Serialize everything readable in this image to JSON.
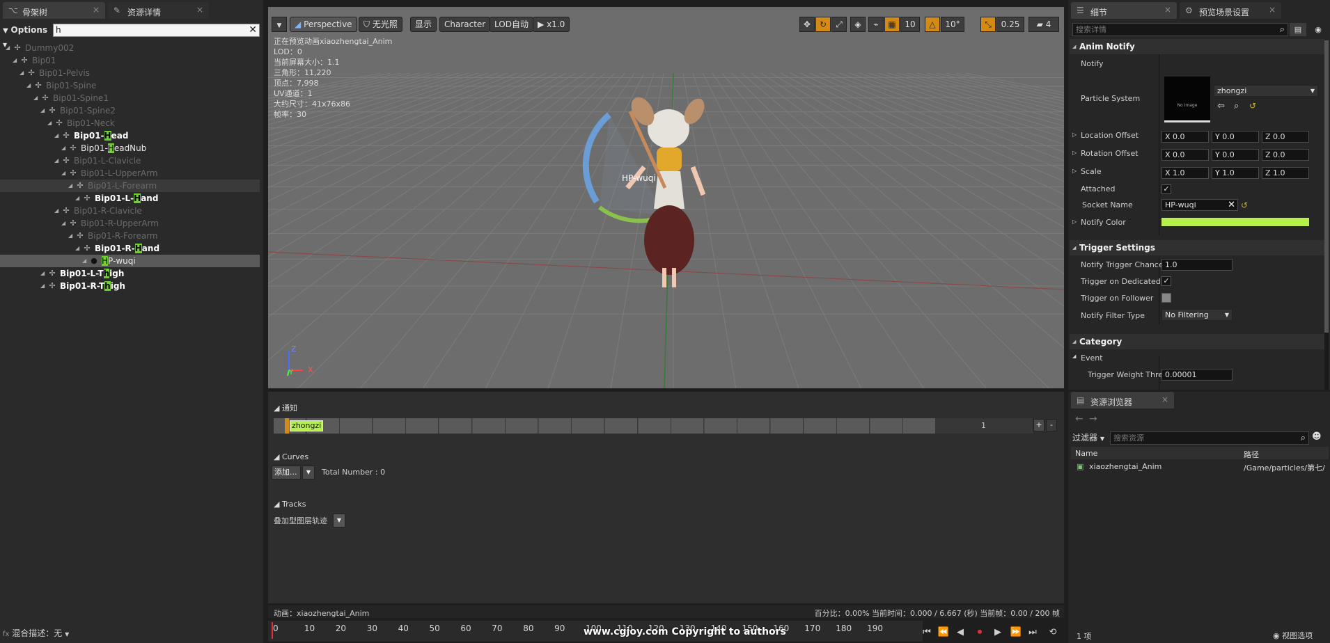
{
  "left_tabs": [
    {
      "label": "骨架树",
      "icon": "skeleton-icon"
    },
    {
      "label": "资源详情",
      "icon": "asset-details-icon"
    }
  ],
  "tree": {
    "options_label": "Options",
    "search_value": "h",
    "rows": [
      {
        "pre": "",
        "hl": "",
        "post": "Dummy002",
        "style": "dim",
        "indent": 0
      },
      {
        "pre": "",
        "hl": "",
        "post": "Bip01",
        "style": "dim",
        "indent": 1
      },
      {
        "pre": "",
        "hl": "",
        "post": "Bip01-Pelvis",
        "style": "dim",
        "indent": 2
      },
      {
        "pre": "",
        "hl": "",
        "post": "Bip01-Spine",
        "style": "dim",
        "indent": 3
      },
      {
        "pre": "",
        "hl": "",
        "post": "Bip01-Spine1",
        "style": "dim",
        "indent": 4
      },
      {
        "pre": "",
        "hl": "",
        "post": "Bip01-Spine2",
        "style": "dim",
        "indent": 5
      },
      {
        "pre": "",
        "hl": "",
        "post": "Bip01-Neck",
        "style": "dim",
        "indent": 6
      },
      {
        "pre": "Bip01-",
        "hl": "H",
        "post": "ead",
        "style": "bright",
        "indent": 7
      },
      {
        "pre": "Bip01-",
        "hl": "H",
        "post": "eadNub",
        "style": "normal",
        "indent": 8
      },
      {
        "pre": "",
        "hl": "",
        "post": "Bip01-L-Clavicle",
        "style": "dim",
        "indent": 7
      },
      {
        "pre": "",
        "hl": "",
        "post": "Bip01-L-UpperArm",
        "style": "dim",
        "indent": 8
      },
      {
        "pre": "",
        "hl": "",
        "post": "Bip01-L-Forearm",
        "style": "dim",
        "indent": 9
      },
      {
        "pre": "Bip01-L-",
        "hl": "H",
        "post": "and",
        "style": "bright",
        "indent": 10
      },
      {
        "pre": "",
        "hl": "",
        "post": "Bip01-R-Clavicle",
        "style": "dim",
        "indent": 7
      },
      {
        "pre": "",
        "hl": "",
        "post": "Bip01-R-UpperArm",
        "style": "dim",
        "indent": 8
      },
      {
        "pre": "",
        "hl": "",
        "post": "Bip01-R-Forearm",
        "style": "dim",
        "indent": 9
      },
      {
        "pre": "Bip01-R-",
        "hl": "H",
        "post": "and",
        "style": "bright",
        "indent": 10
      },
      {
        "pre": "",
        "hl": "H",
        "post": "P-wuqi",
        "style": "socket",
        "indent": 11
      },
      {
        "pre": "Bip01-L-T",
        "hl": "h",
        "post": "igh",
        "style": "bright",
        "indent": 5
      },
      {
        "pre": "Bip01-R-T",
        "hl": "h",
        "post": "igh",
        "style": "bright",
        "indent": 5
      }
    ],
    "bottom_label": "混合描述：无"
  },
  "viewport": {
    "toolbar": {
      "perspective": "Perspective",
      "lighting": "无光照",
      "show": "显示",
      "character": "Character",
      "lod": "LOD自动",
      "speed": "x1.0",
      "grid_snap": "10",
      "rot_snap": "10°",
      "scale_snap": "0.25",
      "cam_speed": "4"
    },
    "info_lines": [
      "正在预览动画xiaozhengtai_Anim",
      "LOD：0",
      "当前屏幕大小：1.1",
      "三角形：11,220",
      "顶点：7,998",
      "UV通道：1",
      "大约尺寸：41x76x86",
      "帧率：30"
    ],
    "socket_label": "HP-wuqi",
    "axis_z": "Z",
    "axis_y": "Y",
    "axis_x": "X"
  },
  "notify": {
    "section_notify": "通知",
    "notify_name": "zhongzi",
    "track_number": "1",
    "add_btn": "+",
    "remove_btn": "-",
    "section_curves": "Curves",
    "add_label": "添加...",
    "total_number": "Total Number : 0",
    "section_tracks": "Tracks",
    "tracks_dropdown": "叠加型图层轨迹"
  },
  "status": {
    "anim_name": "动画：xiaozhengtai_Anim",
    "progress": "百分比：0.00%  当前时间：0.000 / 6.667 (秒) 当前帧：0.00 / 200 帧"
  },
  "timeline": {
    "ticks": [
      "0",
      "10",
      "20",
      "30",
      "40",
      "50",
      "60",
      "70",
      "80",
      "90",
      "100",
      "110",
      "120",
      "130",
      "140",
      "150",
      "160",
      "170",
      "180",
      "190"
    ],
    "watermark": "www.cgjoy.com Copyright to authors",
    "playhead_fraction": 0.0
  },
  "details": {
    "tabs": [
      {
        "label": "细节",
        "icon": "details-icon"
      },
      {
        "label": "预览场景设置",
        "icon": "scene-settings-icon"
      }
    ],
    "search_placeholder": "搜索详情",
    "anim_notify_title": "Anim Notify",
    "notify_label": "Notify",
    "particle_label": "Particle System",
    "particle_value": "zhongzi",
    "no_image": "No Image",
    "location_label": "Location Offset",
    "rotation_label": "Rotation Offset",
    "scale_label": "Scale",
    "location": [
      "X 0.0",
      "Y 0.0",
      "Z 0.0"
    ],
    "rotation": [
      "X 0.0",
      "Y 0.0",
      "Z 0.0"
    ],
    "scale": [
      "X 1.0",
      "Y 1.0",
      "Z 1.0"
    ],
    "attached_label": "Attached",
    "socket_label": "Socket Name",
    "socket_value": "HP-wuqi",
    "color_label": "Notify Color",
    "notify_color": "#b6f04a",
    "trigger_title": "Trigger Settings",
    "chance_label": "Notify Trigger Chance",
    "chance_value": "1.0",
    "dedicated_label": "Trigger on Dedicated S",
    "follower_label": "Trigger on Follower",
    "filter_label": "Notify Filter Type",
    "filter_value": "No Filtering",
    "category_title": "Category",
    "event_label": "Event",
    "weight_label": "Trigger Weight Thres",
    "weight_value": "0.00001"
  },
  "content_browser": {
    "tab": "资源浏览器",
    "filter_label": "过滤器",
    "search_placeholder": "搜索资源",
    "col_name": "Name",
    "col_path": "路径",
    "asset_name": "xiaozhengtai_Anim",
    "asset_path": "/Game/particles/第七/",
    "count": "1 项",
    "view_options": "视图选项"
  },
  "colors": {
    "accent": "#d48b16",
    "highlight": "#6ed12f",
    "notify_green": "#b6f04a"
  }
}
